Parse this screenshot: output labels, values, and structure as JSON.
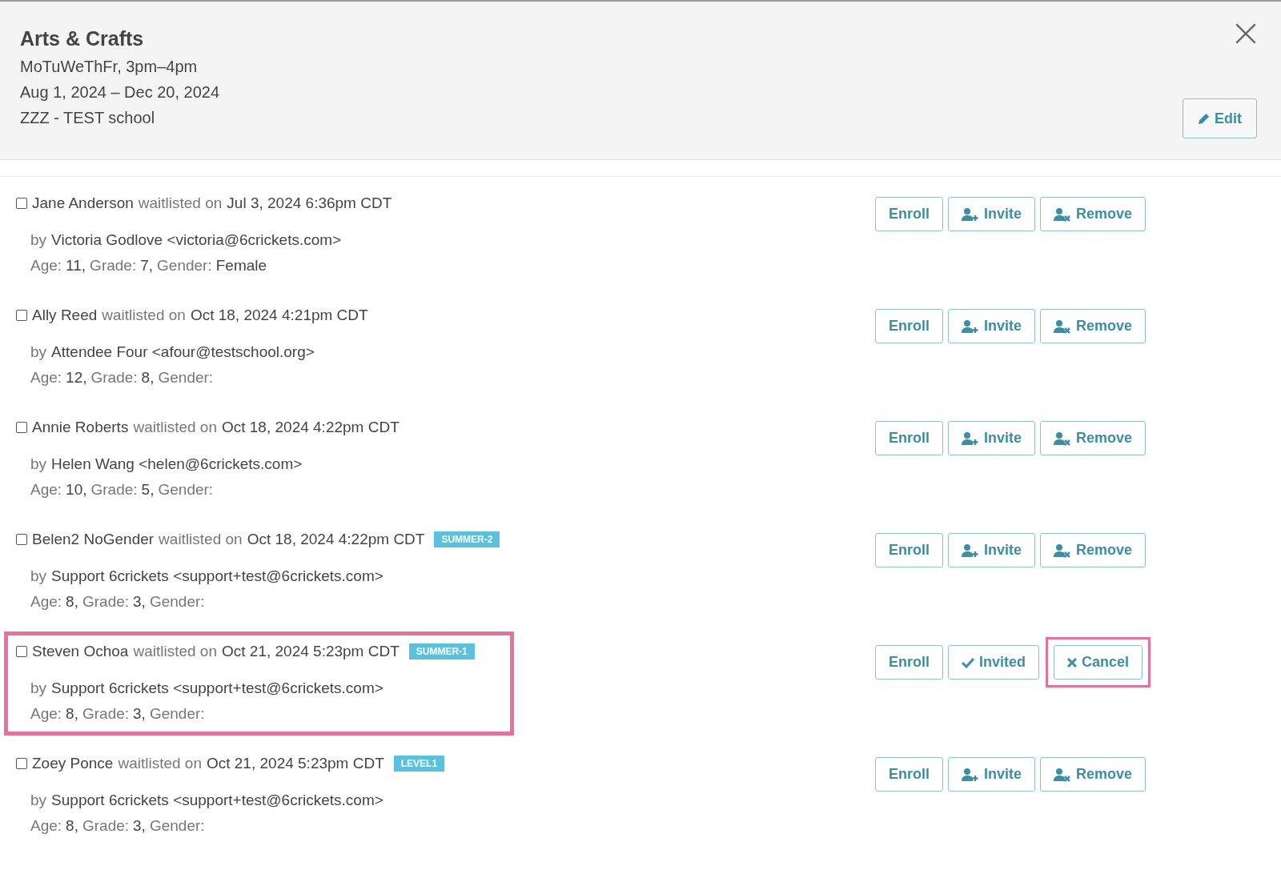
{
  "header": {
    "title": "Arts & Crafts",
    "schedule": "MoTuWeThFr, 3pm–4pm",
    "dates": "Aug 1, 2024 – Dec 20, 2024",
    "school": "ZZZ - TEST school",
    "edit_button": "Edit"
  },
  "entries": [
    {
      "checked": false,
      "highlighted": false,
      "name": "Jane Anderson",
      "waitlisted": "waitlisted on",
      "date": "Jul 3, 2024 6:36pm CDT",
      "by": "by",
      "parent": "Victoria Godlove <victoria@6crickets.com>",
      "fields": [
        {
          "label": "Age:",
          "value": "11,"
        },
        {
          "label": "Grade:",
          "value": "7,"
        },
        {
          "label": "Gender:",
          "value": "Female"
        }
      ],
      "actions": [
        {
          "kind": "enroll",
          "label": "Enroll",
          "highlighted": false
        },
        {
          "kind": "invite",
          "label": "Invite",
          "highlighted": false
        },
        {
          "kind": "remove",
          "label": "Remove",
          "highlighted": false
        }
      ]
    },
    {
      "checked": false,
      "highlighted": false,
      "name": "Ally Reed",
      "waitlisted": "waitlisted on",
      "date": "Oct 18, 2024 4:21pm CDT",
      "by": "by",
      "parent": "Attendee Four <afour@testschool.org>",
      "fields": [
        {
          "label": "Age:",
          "value": "12,"
        },
        {
          "label": "Grade:",
          "value": "8,"
        },
        {
          "label": "Gender:"
        }
      ],
      "actions": [
        {
          "kind": "enroll",
          "label": "Enroll",
          "highlighted": false
        },
        {
          "kind": "invite",
          "label": "Invite",
          "highlighted": false
        },
        {
          "kind": "remove",
          "label": "Remove",
          "highlighted": false
        }
      ]
    },
    {
      "checked": false,
      "highlighted": false,
      "name": "Annie Roberts",
      "waitlisted": "waitlisted on",
      "date": "Oct 18, 2024 4:22pm CDT",
      "by": "by",
      "parent": "Helen Wang <helen@6crickets.com>",
      "fields": [
        {
          "label": "Age:",
          "value": "10,"
        },
        {
          "label": "Grade:",
          "value": "5,"
        },
        {
          "label": "Gender:"
        }
      ],
      "actions": [
        {
          "kind": "enroll",
          "label": "Enroll",
          "highlighted": false
        },
        {
          "kind": "invite",
          "label": "Invite",
          "highlighted": false
        },
        {
          "kind": "remove",
          "label": "Remove",
          "highlighted": false
        }
      ]
    },
    {
      "checked": false,
      "highlighted": false,
      "name": "Belen2 NoGender",
      "waitlisted": "waitlisted on",
      "date": "Oct 18, 2024 4:22pm CDT",
      "tag": "SUMMER-2",
      "by": "by",
      "parent": "Support 6crickets <support+test@6crickets.com>",
      "fields": [
        {
          "label": "Age:",
          "value": "8,"
        },
        {
          "label": "Grade:",
          "value": "3,"
        },
        {
          "label": "Gender:"
        }
      ],
      "actions": [
        {
          "kind": "enroll",
          "label": "Enroll",
          "highlighted": false
        },
        {
          "kind": "invite",
          "label": "Invite",
          "highlighted": false
        },
        {
          "kind": "remove",
          "label": "Remove",
          "highlighted": false
        }
      ]
    },
    {
      "checked": false,
      "highlighted": true,
      "name": "Steven Ochoa",
      "waitlisted": "waitlisted on",
      "date": "Oct 21, 2024 5:23pm CDT",
      "tag": "SUMMER-1",
      "by": "by",
      "parent": "Support 6crickets <support+test@6crickets.com>",
      "fields": [
        {
          "label": "Age:",
          "value": "8,"
        },
        {
          "label": "Grade:",
          "value": "3,"
        },
        {
          "label": "Gender:"
        }
      ],
      "actions": [
        {
          "kind": "enroll",
          "label": "Enroll",
          "highlighted": false
        },
        {
          "kind": "invited",
          "label": "Invited",
          "highlighted": false
        },
        {
          "kind": "cancel",
          "label": "Cancel",
          "highlighted": true
        }
      ]
    },
    {
      "checked": false,
      "highlighted": false,
      "name": "Zoey Ponce",
      "waitlisted": "waitlisted on",
      "date": "Oct 21, 2024 5:23pm CDT",
      "tag": "LEVEL1",
      "by": "by",
      "parent": "Support 6crickets <support+test@6crickets.com>",
      "fields": [
        {
          "label": "Age:",
          "value": "8,"
        },
        {
          "label": "Grade:",
          "value": "3,"
        },
        {
          "label": "Gender:"
        }
      ],
      "actions": [
        {
          "kind": "enroll",
          "label": "Enroll",
          "highlighted": false
        },
        {
          "kind": "invite",
          "label": "Invite",
          "highlighted": false
        },
        {
          "kind": "remove",
          "label": "Remove",
          "highlighted": false
        }
      ]
    }
  ]
}
